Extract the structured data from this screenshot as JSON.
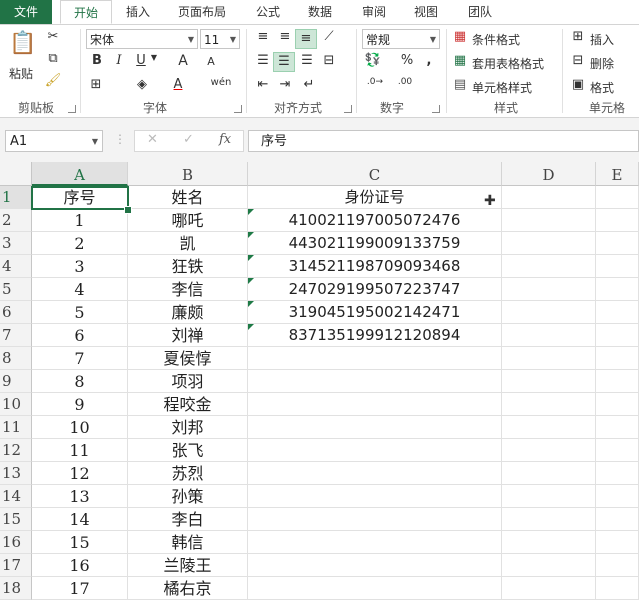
{
  "tabs": [
    "文件",
    "开始",
    "插入",
    "页面布局",
    "公式",
    "数据",
    "审阅",
    "视图",
    "团队"
  ],
  "ribbon": {
    "clipboard": {
      "paste": "粘贴",
      "label": "剪贴板"
    },
    "font": {
      "name": "宋体",
      "size": "11",
      "label": "字体",
      "bold": "B",
      "italic": "I",
      "underline": "U",
      "grow": "A",
      "shrink": "A",
      "color_a": "A",
      "wen": "wén"
    },
    "alignment": {
      "label": "对齐方式"
    },
    "number": {
      "format": "常规",
      "label": "数字",
      "percent": "%",
      "comma": ","
    },
    "styles": {
      "conditional": "条件格式",
      "table": "套用表格格式",
      "cell": "单元格样式",
      "label": "样式"
    },
    "cells": {
      "insert": "插入",
      "delete": "删除",
      "format": "格式",
      "label": "单元格"
    }
  },
  "formula_bar": {
    "name_box": "A1",
    "cancel": "✕",
    "enter": "✓",
    "fx": "fx",
    "content": "序号"
  },
  "columns": [
    "A",
    "B",
    "C",
    "D",
    "E"
  ],
  "rows": [
    {
      "n": "1",
      "a": "序号",
      "b": "姓名",
      "c": "身份证号"
    },
    {
      "n": "2",
      "a": "1",
      "b": "哪吒",
      "c": "410021197005072476"
    },
    {
      "n": "3",
      "a": "2",
      "b": "凯",
      "c": "443021199009133759"
    },
    {
      "n": "4",
      "a": "3",
      "b": "狂铁",
      "c": "314521198709093468"
    },
    {
      "n": "5",
      "a": "4",
      "b": "李信",
      "c": "247029199507223747"
    },
    {
      "n": "6",
      "a": "5",
      "b": "廉颇",
      "c": "319045195002142471"
    },
    {
      "n": "7",
      "a": "6",
      "b": "刘禅",
      "c": "837135199912120894"
    },
    {
      "n": "8",
      "a": "7",
      "b": "夏侯惇",
      "c": ""
    },
    {
      "n": "9",
      "a": "8",
      "b": "项羽",
      "c": ""
    },
    {
      "n": "10",
      "a": "9",
      "b": "程咬金",
      "c": ""
    },
    {
      "n": "11",
      "a": "10",
      "b": "刘邦",
      "c": ""
    },
    {
      "n": "12",
      "a": "11",
      "b": "张飞",
      "c": ""
    },
    {
      "n": "13",
      "a": "12",
      "b": "苏烈",
      "c": ""
    },
    {
      "n": "14",
      "a": "13",
      "b": "孙策",
      "c": ""
    },
    {
      "n": "15",
      "a": "14",
      "b": "李白",
      "c": ""
    },
    {
      "n": "16",
      "a": "15",
      "b": "韩信",
      "c": ""
    },
    {
      "n": "17",
      "a": "16",
      "b": "兰陵王",
      "c": ""
    },
    {
      "n": "18",
      "a": "17",
      "b": "橘右京",
      "c": ""
    }
  ],
  "accent": "#217346"
}
